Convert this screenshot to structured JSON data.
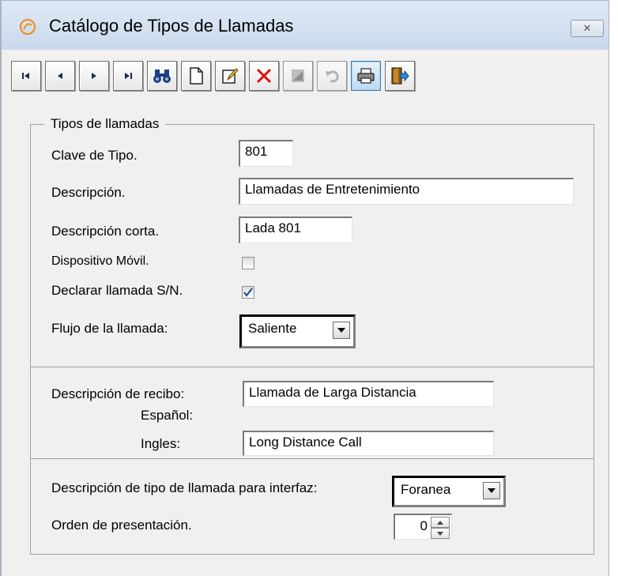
{
  "window": {
    "title": "Catálogo de Tipos de Llamadas",
    "close_label": "✕"
  },
  "toolbar": {
    "buttons": [
      {
        "name": "first-record",
        "icon": "skip-first-icon"
      },
      {
        "name": "previous-record",
        "icon": "arrow-left-icon"
      },
      {
        "name": "next-record",
        "icon": "arrow-right-icon"
      },
      {
        "name": "last-record",
        "icon": "skip-last-icon"
      },
      {
        "name": "search",
        "icon": "binoculars-icon"
      },
      {
        "name": "new",
        "icon": "new-document-icon"
      },
      {
        "name": "edit",
        "icon": "edit-icon"
      },
      {
        "name": "delete",
        "icon": "delete-x-icon"
      },
      {
        "name": "save",
        "icon": "save-icon",
        "disabled": true
      },
      {
        "name": "undo",
        "icon": "undo-icon",
        "disabled": true
      },
      {
        "name": "print",
        "icon": "printer-icon",
        "pressed": true
      },
      {
        "name": "exit",
        "icon": "exit-door-icon"
      }
    ]
  },
  "section1": {
    "legend": "Tipos de llamadas",
    "clave_label": "Clave de Tipo.",
    "clave_value": "801",
    "descripcion_label": "Descripción.",
    "descripcion_value": "Llamadas de Entretenimiento",
    "desc_corta_label": "Descripción corta.",
    "desc_corta_value": "Lada 801",
    "movil_label": "Dispositivo Móvil.",
    "movil_checked": false,
    "declarar_label": "Declarar llamada S/N.",
    "declarar_checked": true,
    "flujo_label": "Flujo de la llamada:",
    "flujo_value": "Saliente"
  },
  "section2": {
    "recibo_label": "Descripción de recibo:",
    "espanol_label": "Español:",
    "espanol_value": "Llamada de Larga Distancia",
    "ingles_label": "Ingles:",
    "ingles_value": "Long Distance Call"
  },
  "section3": {
    "interfaz_label": "Descripción de tipo de llamada para interfaz:",
    "interfaz_value": "Foranea",
    "orden_label": "Orden de presentación.",
    "orden_value": "0"
  },
  "colors": {
    "titlebar": "#c9d9ec",
    "window_bg": "#f0f0f0",
    "delete_red": "#e01010",
    "check_blue": "#1a4f9c"
  }
}
